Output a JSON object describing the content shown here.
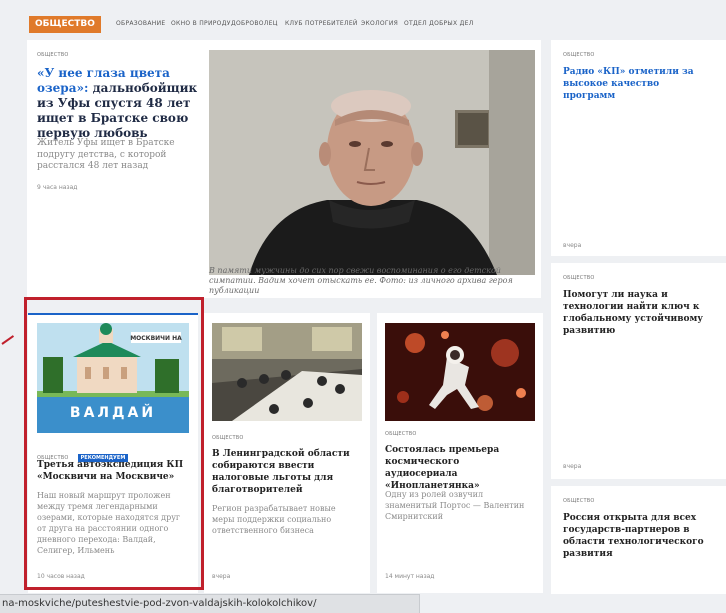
{
  "nav": {
    "section": "ОБЩЕСТВО",
    "links": [
      "ОБРАЗОВАНИЕ",
      "ОКНО В ПРИРОДУ",
      "ДОБРОВОЛЕЦ",
      "КЛУБ ПОТРЕБИТЕЛЕЙ",
      "ЭКОЛОГИЯ",
      "ОТДЕЛ ДОБРЫХ ДЕЛ"
    ]
  },
  "feature": {
    "tag": "ОБЩЕСТВО",
    "title_quote": "«У нее глаза цвета озера»:",
    "title_rest": "дальнобойщик из Уфы спустя 48 лет ищет в Братске свою первую любовь",
    "lead": "Житель Уфы ищет в Братске подругу детства, с которой расстался 48 лет назад",
    "time": "9 часа назад",
    "caption": "В памяти мужчины до сих пор свежи воспоминания о его детской симпатии. Вадим хочет отыскать ее. Фото: из личного архива героя публикации"
  },
  "side": [
    {
      "tag": "ОБЩЕСТВО",
      "title": "Радио «КП» отметили за высокое качество программ",
      "time": "вчера"
    },
    {
      "tag": "ОБЩЕСТВО",
      "title": "Помогут ли наука и технологии найти ключ к глобальному устойчивому развитию",
      "time": "вчера"
    },
    {
      "tag": "ОБЩЕСТВО",
      "title": "Россия открыта для всех государств-партнеров в области технологического развития"
    }
  ],
  "cards": [
    {
      "tags": [
        "ОБЩЕСТВО",
        "РЕКОМЕНДУЕМ"
      ],
      "image_logo": "МОСКВИЧИ НА",
      "image_text": "ВАЛДАЙ",
      "title": "Третья автоэкспедиция КП «Москвичи на Москвиче»",
      "lead": "Наш новый маршрут проложен между тремя легендарными озерами, которые находятся друг от друга на расстоянии одного дневного перехода: Валдай, Селигер, Ильмень",
      "time": "10 часов назад"
    },
    {
      "tag": "ОБЩЕСТВО",
      "title": "В Ленинградской области собираются ввести налоговые льготы для благотворителей",
      "lead": "Регион разрабатывает новые меры поддержки социально ответственного бизнеса",
      "time": "вчера"
    },
    {
      "tag": "ОБЩЕСТВО",
      "title": "Состоялась премьера космического аудиосериала «Инопланетянка»",
      "lead": "Одну из ролей озвучил знаменитый Портос — Валентин Смирнитский",
      "time": "14 минут назад"
    }
  ],
  "url": "na-moskviche/puteshestvie-pod-zvon-valdajskih-kolokolchikov/",
  "colors": {
    "accent_orange": "#e07a2a",
    "link_blue": "#1a63c8",
    "highlight_red": "#c0202c"
  }
}
